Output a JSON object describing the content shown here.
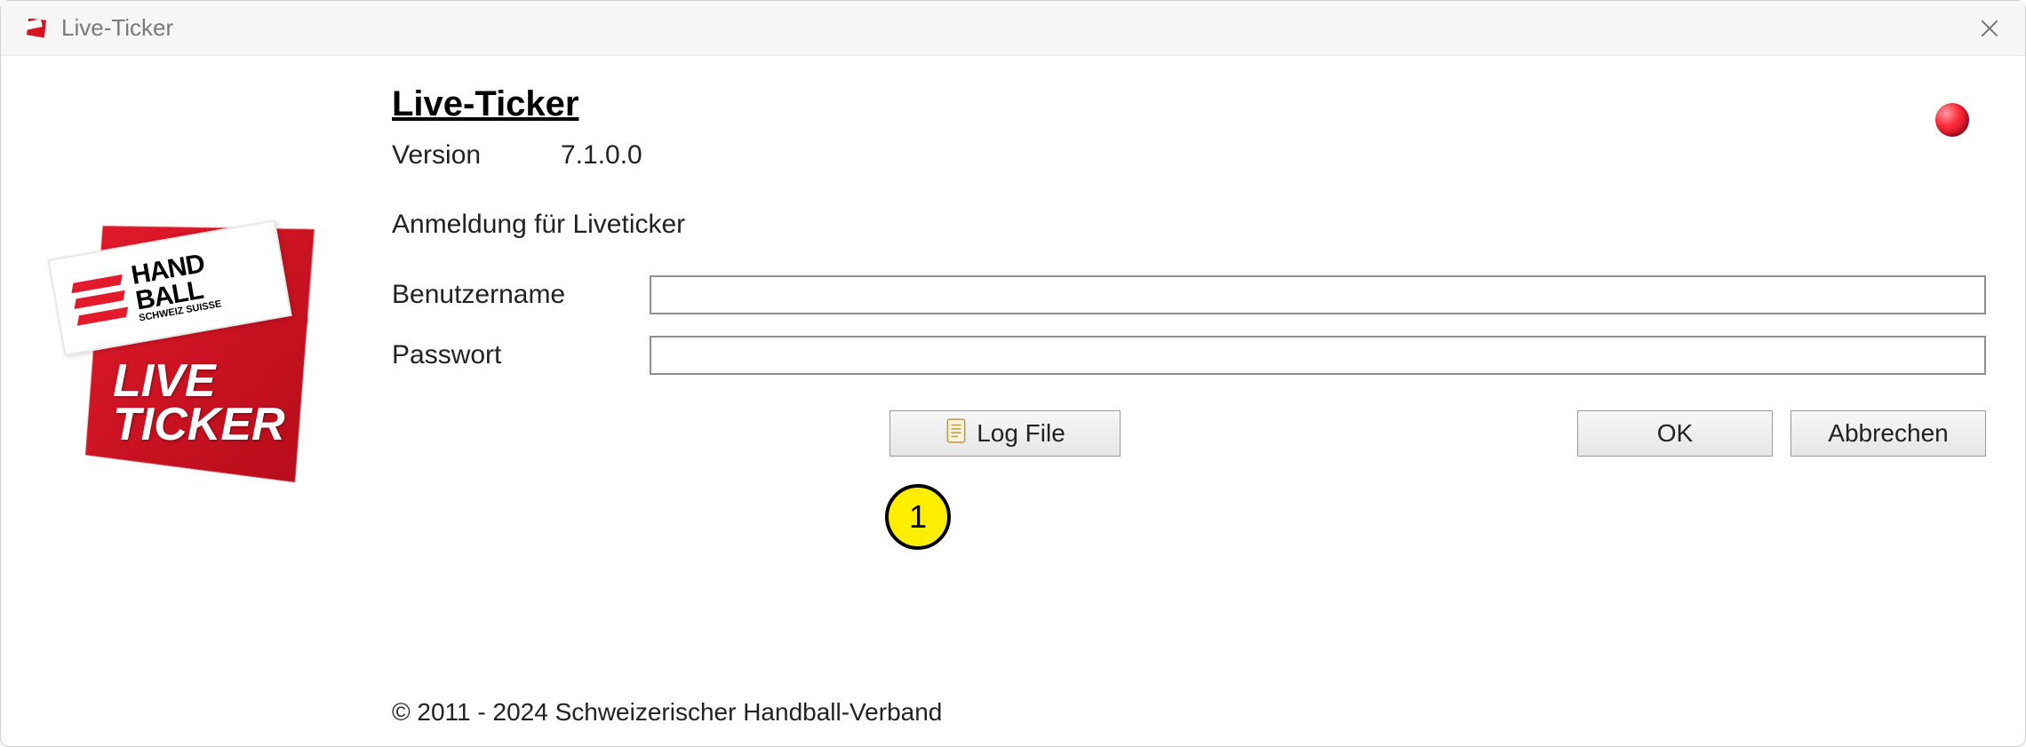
{
  "window": {
    "title": "Live-Ticker"
  },
  "main": {
    "heading": "Live-Ticker",
    "version_label": "Version",
    "version_value": "7.1.0.0",
    "subtitle": "Anmeldung für Liveticker"
  },
  "form": {
    "username_label": "Benutzername",
    "username_value": "",
    "password_label": "Passwort",
    "password_value": ""
  },
  "buttons": {
    "logfile": "Log File",
    "ok": "OK",
    "cancel": "Abbrechen"
  },
  "logo": {
    "line1": "HAND",
    "line2": "BALL",
    "sub": "SCHWEIZ\nSUISSE",
    "live1": "LIVE",
    "live2": "TICKER"
  },
  "footer": {
    "copyright": "© 2011 - 2024 Schweizerischer Handball-Verband"
  },
  "annotation": {
    "marker1": "1"
  }
}
